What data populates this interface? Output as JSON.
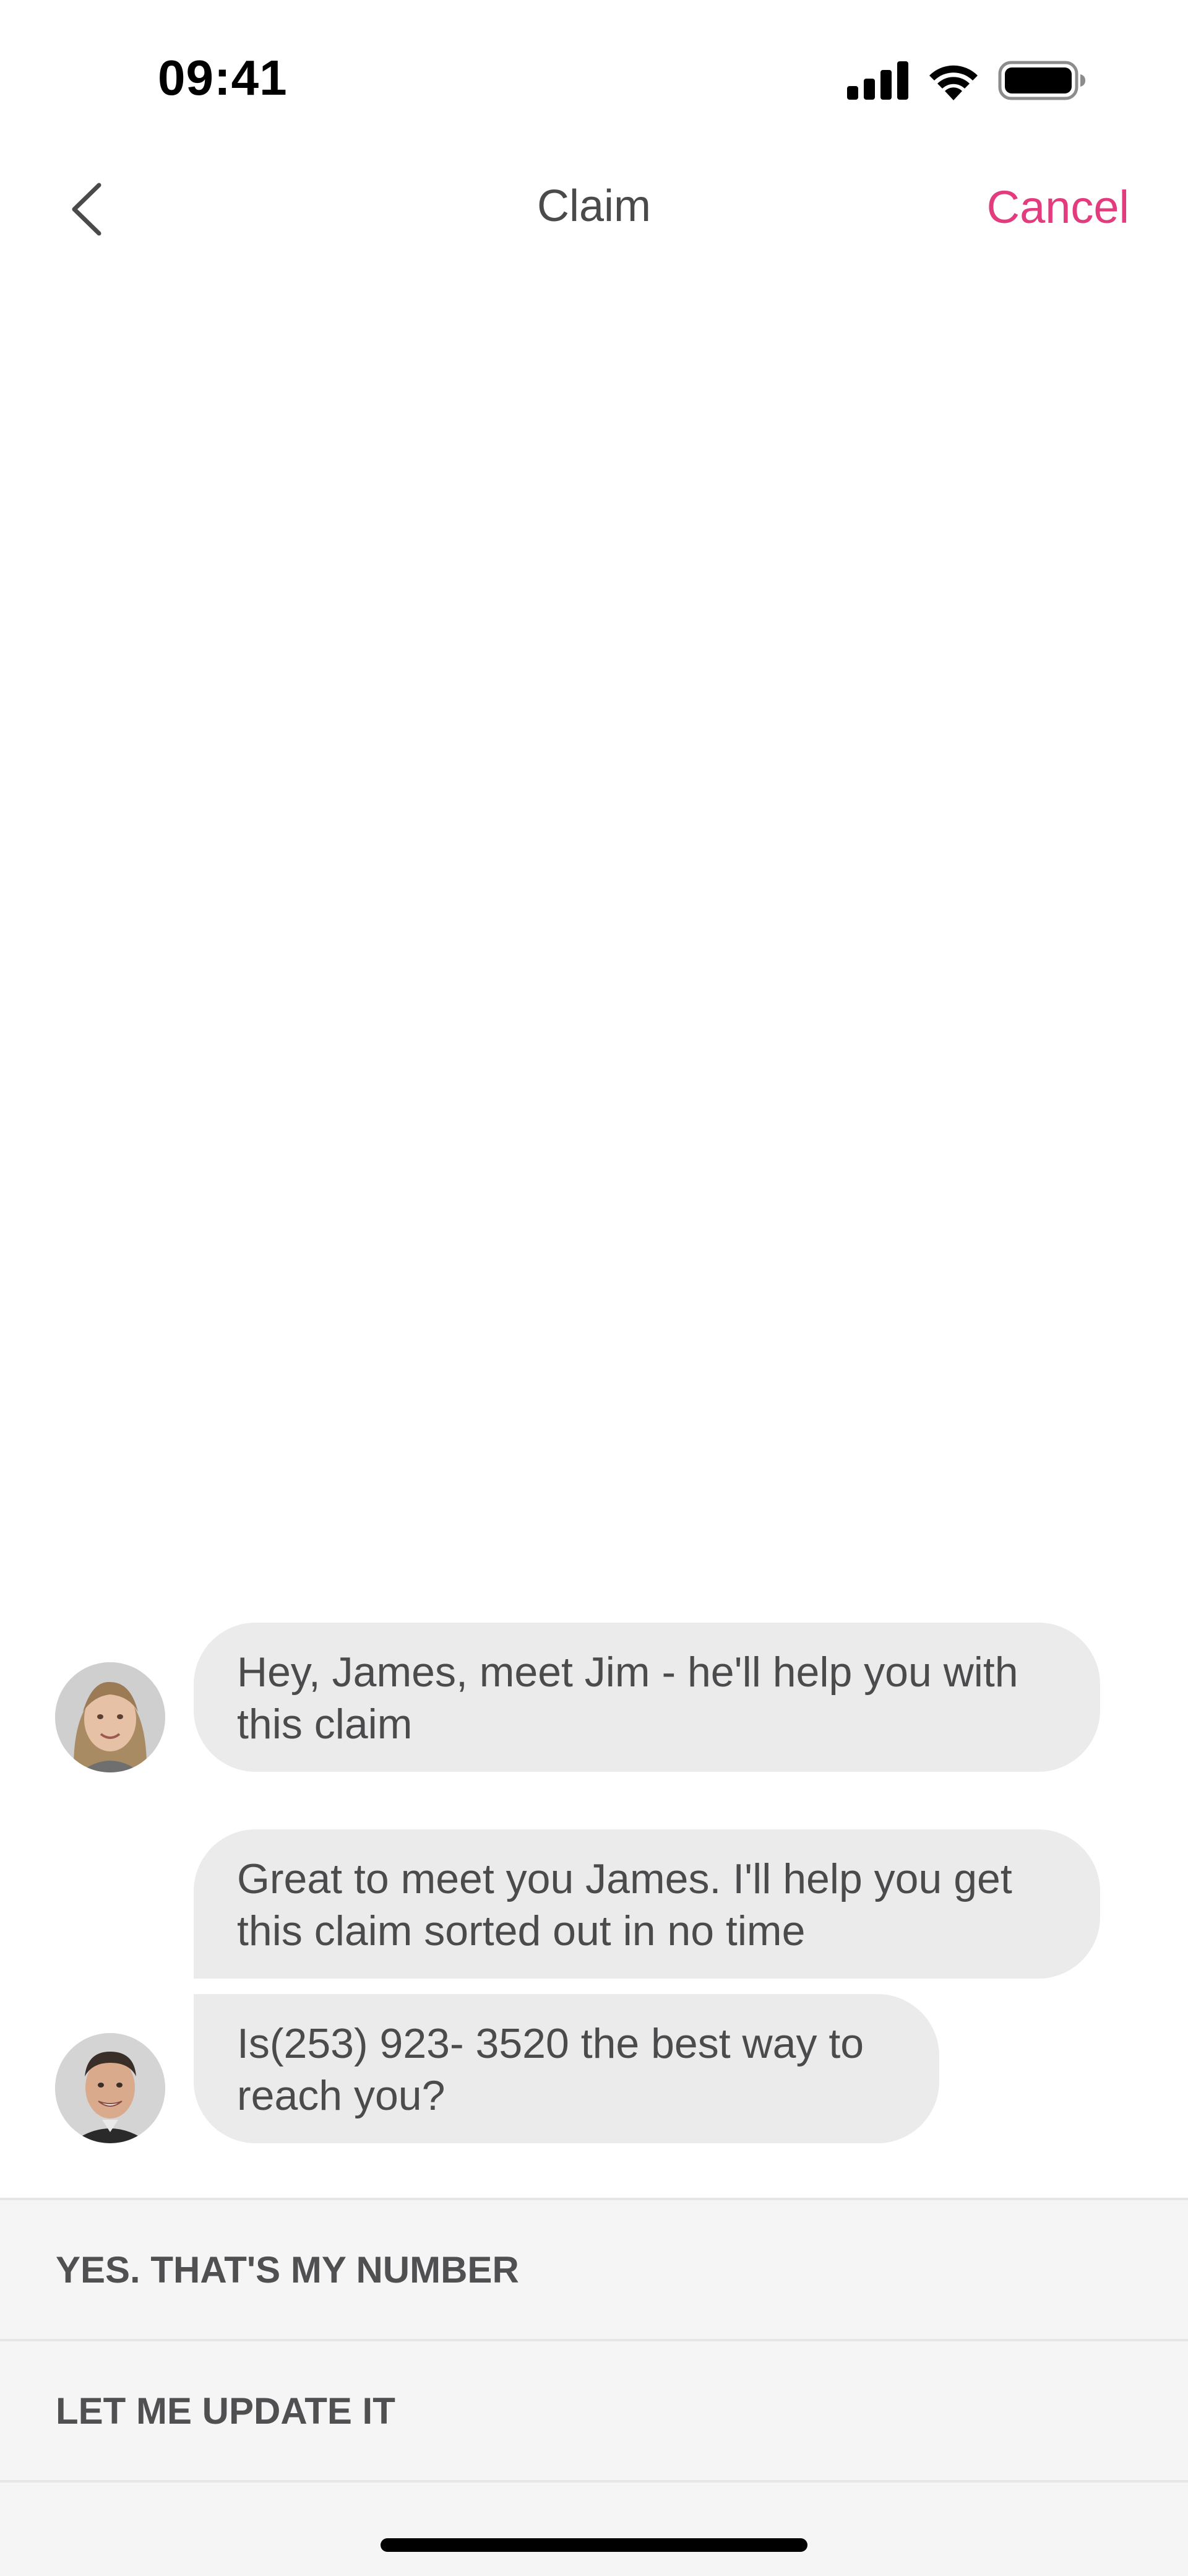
{
  "status_bar": {
    "time": "09:41",
    "icons": [
      "cellular-signal-icon",
      "wifi-icon",
      "battery-icon"
    ]
  },
  "nav": {
    "back_icon": "chevron-left-icon",
    "title": "Claim",
    "cancel_label": "Cancel"
  },
  "chat": {
    "messages": [
      {
        "sender": "agent",
        "avatar": "female-agent-avatar",
        "text": "Hey,  James, meet Jim - he'll help you with this claim"
      },
      {
        "sender": "jim",
        "text": "Great to meet you James.  I'll help you get this claim sorted out in no time"
      },
      {
        "sender": "jim",
        "avatar": "male-agent-avatar",
        "text": "Is(253) 923- 3520 the best way to reach you?"
      }
    ]
  },
  "quick_replies": [
    {
      "label": "YES. THAT'S MY NUMBER"
    },
    {
      "label": "LET ME UPDATE IT"
    }
  ],
  "colors": {
    "accent": "#e23b7e",
    "bubble": "#ebebeb",
    "reply_panel": "#f5f5f5",
    "text": "#4b4b4d"
  }
}
